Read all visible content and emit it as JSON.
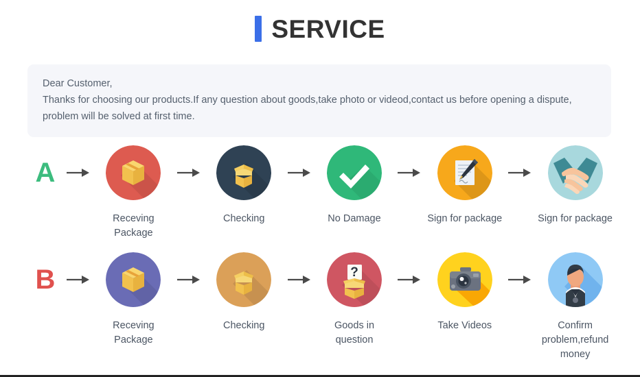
{
  "header": {
    "title": "SERVICE",
    "accent_color": "#3b6fe8"
  },
  "notice": {
    "line1": "Dear Customer,",
    "line2": "Thanks for choosing our products.If any question about goods,take photo or videod,contact us before opening a dispute,",
    "line3": "problem will be solved at first time.",
    "background_color": "#f5f6fa",
    "text_color": "#55606e"
  },
  "rows": [
    {
      "letter": "A",
      "letter_color": "#3cbc7e",
      "steps": [
        {
          "label": "Receving Package",
          "icon": "closed-box-icon",
          "circle_color": "#dd5b50"
        },
        {
          "label": "Checking",
          "icon": "open-box-icon",
          "circle_color": "#2f4254"
        },
        {
          "label": "No Damage",
          "icon": "check-mark-icon",
          "circle_color": "#2fb879"
        },
        {
          "label": "Sign for package",
          "icon": "document-pen-icon",
          "circle_color": "#f7a81b"
        },
        {
          "label": "Sign for package",
          "icon": "handshake-icon",
          "circle_color": "#a8d8dd"
        }
      ]
    },
    {
      "letter": "B",
      "letter_color": "#e0514e",
      "steps": [
        {
          "label": "Receving Package",
          "icon": "closed-box-icon",
          "circle_color": "#6a6cb5"
        },
        {
          "label": "Checking",
          "icon": "open-box-icon",
          "circle_color": "#dba058"
        },
        {
          "label": "Goods in question",
          "icon": "question-box-icon",
          "circle_color": "#cf5662"
        },
        {
          "label": "Take Videos",
          "icon": "camera-icon",
          "circle_color": "#ffd21e"
        },
        {
          "label": "Confirm problem,refund money",
          "icon": "person-icon",
          "circle_color": "#8fc9f5"
        }
      ]
    }
  ],
  "arrow": {
    "name": "right-arrow-icon",
    "color": "#4a4a4a"
  }
}
